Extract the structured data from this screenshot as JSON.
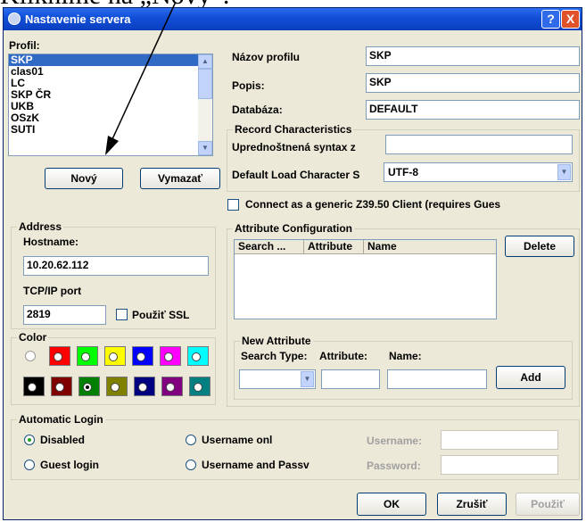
{
  "caption": "Kliknime na „Nový“.",
  "window": {
    "title": "Nastavenie servera",
    "help_glyph": "?",
    "close_glyph": "X"
  },
  "profile": {
    "label": "Profil:",
    "items": [
      {
        "label": "SKP",
        "selected": true
      },
      {
        "label": "clas01"
      },
      {
        "label": "LC"
      },
      {
        "label": "SKP ČR"
      },
      {
        "label": "UKB"
      },
      {
        "label": "OSzK"
      },
      {
        "label": "SUTI"
      }
    ],
    "new_button": "Nový",
    "delete_button": "Vymazať"
  },
  "form": {
    "profile_name_label": "Názov profilu",
    "profile_name_value": "SKP",
    "description_label": "Popis:",
    "description_value": "SKP",
    "database_label": "Databáza:",
    "database_value": "DEFAULT"
  },
  "record": {
    "legend": "Record Characteristics",
    "syntax_label": "Uprednoštnená syntax z",
    "syntax_value": "",
    "charset_label": "Default Load Character S",
    "charset_value": "UTF-8"
  },
  "generic_client": {
    "label": "Connect as a generic Z39.50 Client (requires Gues",
    "checked": false
  },
  "address": {
    "legend": "Address",
    "hostname_label": "Hostname:",
    "hostname_value": "10.20.62.112",
    "port_label": "TCP/IP port",
    "port_value": "2819",
    "ssl_label": "Použiť SSL",
    "ssl_checked": false
  },
  "color": {
    "legend": "Color",
    "row1": [
      "#ff0000",
      "#00ff00",
      "#ffff00",
      "#0000ff",
      "#ff00ff",
      "#00ffff"
    ],
    "row2": [
      "#000000",
      "#800000",
      "#008000",
      "#808000",
      "#000080",
      "#800080",
      "#008080"
    ],
    "selected_index_row2": 2
  },
  "attributes": {
    "legend": "Attribute Configuration",
    "columns": [
      "Search ...",
      "Attribute",
      "Name"
    ],
    "rows": [],
    "delete_button": "Delete"
  },
  "new_attribute": {
    "legend": "New Attribute",
    "search_type_label": "Search Type:",
    "attribute_label": "Attribute:",
    "name_label": "Name:",
    "search_type_value": "",
    "attribute_value": "",
    "name_value": "",
    "add_button": "Add"
  },
  "login": {
    "legend": "Automatic Login",
    "disabled_label": "Disabled",
    "guest_label": "Guest login",
    "username_only_label": "Username onl",
    "username_password_label": "Username and Passv",
    "selected": "disabled",
    "username_label": "Username:",
    "password_label": "Password:",
    "username_value": "",
    "password_value": ""
  },
  "footer": {
    "ok_button": "OK",
    "cancel_button": "Zrušiť",
    "apply_button": "Použiť"
  }
}
